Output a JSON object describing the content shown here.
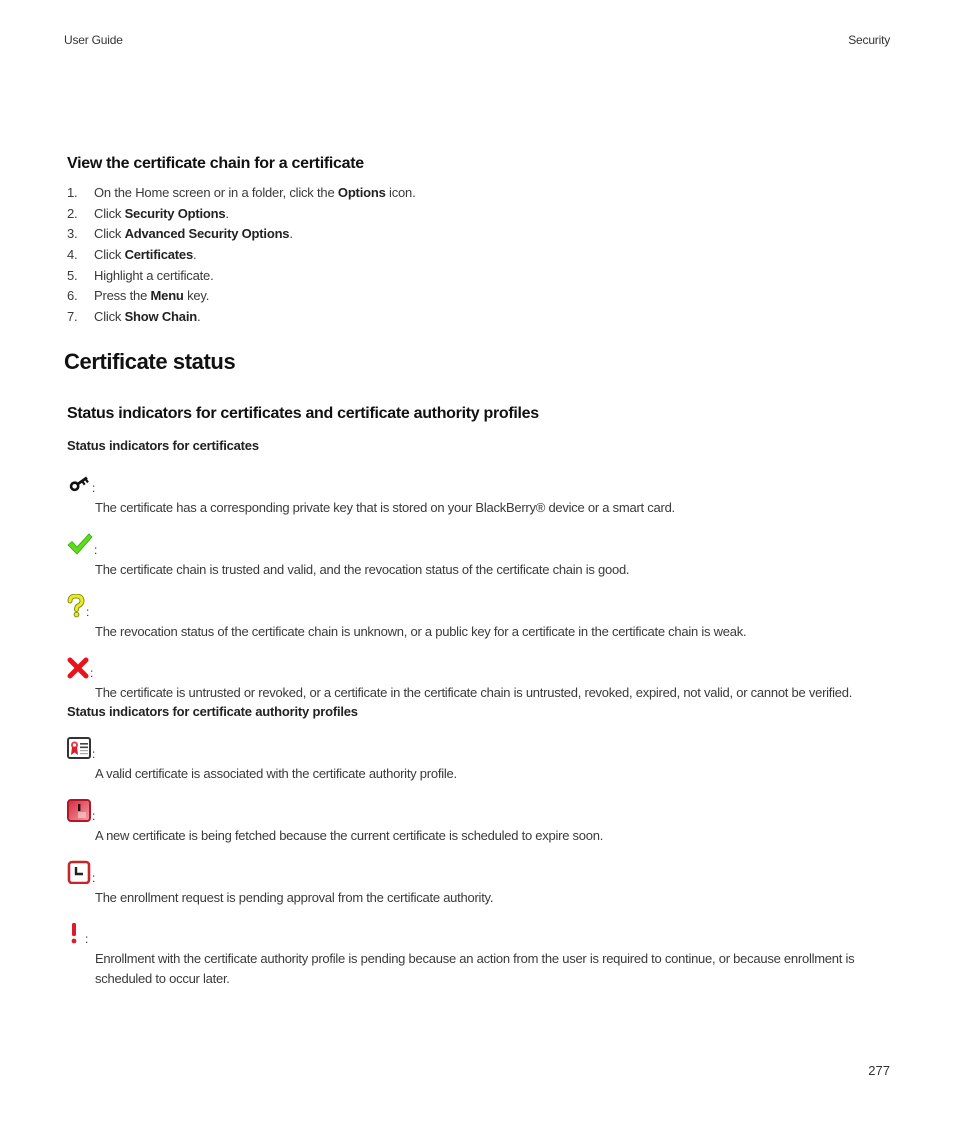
{
  "header": {
    "left": "User Guide",
    "right": "Security"
  },
  "section1": {
    "title": "View the certificate chain for a certificate",
    "steps": [
      {
        "num": "1.",
        "pre": "On the Home screen or in a folder, click the ",
        "bold": "Options",
        "post": " icon."
      },
      {
        "num": "2.",
        "pre": "Click ",
        "bold": "Security Options",
        "post": "."
      },
      {
        "num": "3.",
        "pre": "Click ",
        "bold": "Advanced Security Options",
        "post": "."
      },
      {
        "num": "4.",
        "pre": "Click ",
        "bold": "Certificates",
        "post": "."
      },
      {
        "num": "5.",
        "pre": "Highlight a certificate.",
        "bold": "",
        "post": ""
      },
      {
        "num": "6.",
        "pre": "Press the ",
        "bold": "Menu",
        "post": " key."
      },
      {
        "num": "7.",
        "pre": "Click ",
        "bold": "Show Chain",
        "post": "."
      }
    ]
  },
  "section2": {
    "title": "Certificate status",
    "subtitle": "Status indicators for certificates and certificate authority profiles",
    "certificates": {
      "heading": "Status indicators for certificates",
      "items": [
        {
          "icon": "key-icon",
          "colon": ":",
          "text": "The certificate has a corresponding private key that is stored on your BlackBerry® device or a smart card."
        },
        {
          "icon": "checkmark-icon",
          "colon": ":",
          "text": "The certificate chain is trusted and valid, and the revocation status of the certificate chain is good."
        },
        {
          "icon": "question-mark-icon",
          "colon": ":",
          "text": "The revocation status of the certificate chain is unknown, or a public key for a certificate in the certificate chain is weak."
        },
        {
          "icon": "red-x-icon",
          "colon": ":",
          "text": "The certificate is untrusted or revoked, or a certificate in the certificate chain is untrusted, revoked, expired, not valid, or cannot be verified."
        }
      ]
    },
    "ca_profiles": {
      "heading": "Status indicators for certificate authority profiles",
      "items": [
        {
          "icon": "valid-certificate-icon",
          "colon": ":",
          "text": "A valid certificate is associated with the certificate authority profile."
        },
        {
          "icon": "expiring-certificate-icon",
          "colon": ":",
          "text": "A new certificate is being fetched because the current certificate is scheduled to expire soon."
        },
        {
          "icon": "pending-clock-icon",
          "colon": ":",
          "text": "The enrollment request is pending approval from the certificate authority."
        },
        {
          "icon": "exclamation-icon",
          "colon": ":",
          "text": "Enrollment with the certificate authority profile is pending because an action from the user is required to continue, or because enrollment is scheduled to occur later."
        }
      ]
    }
  },
  "colors": {
    "check_green": "#5ddc1c",
    "question_yellow": "#d8e41c",
    "x_red": "#e8141c",
    "ca_red": "#c8242c"
  },
  "page_number": "277"
}
